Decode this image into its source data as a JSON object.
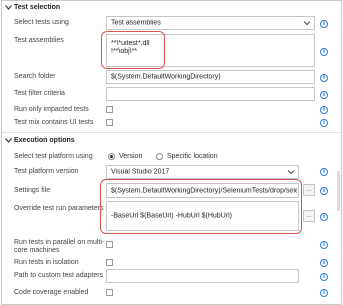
{
  "test_selection": {
    "title": "Test selection",
    "select_tests_using": {
      "label": "Select tests using",
      "value": "Test assemblies"
    },
    "test_assemblies": {
      "label": "Test assemblies",
      "value": "**\\*uitest*.dll\n!**\\obj\\**"
    },
    "search_folder": {
      "label": "Search folder",
      "value": "$(System.DefaultWorkingDirectory)"
    },
    "test_filter_criteria": {
      "label": "Test filter criteria",
      "value": ""
    },
    "run_only_impacted": {
      "label": "Run only impacted tests"
    },
    "test_mix_ui": {
      "label": "Test mix contains UI tests"
    }
  },
  "execution_options": {
    "title": "Execution options",
    "select_platform": {
      "label": "Select test platform using",
      "option_version": "Version",
      "option_location": "Specific location"
    },
    "platform_version": {
      "label": "Test platform version",
      "value": "Visual Studio 2017"
    },
    "settings_file": {
      "label": "Settings file",
      "value": "$(System.DefaultWorkingDirectory)/SeleniumTests/drop/sele",
      "browse": "..."
    },
    "override_params": {
      "label": "Override test run parameters",
      "value": "-BaseUrl $(BaseUrl) -HubUrl $(HubUrl)",
      "browse": "..."
    },
    "run_parallel": {
      "label_line1": "Run tests in parallel on multi-",
      "label_line2": "core machines"
    },
    "run_isolation": {
      "label": "Run tests in isolation"
    },
    "custom_adapters": {
      "label": "Path to custom test adapters",
      "value": ""
    },
    "code_coverage": {
      "label": "Code coverage enabled"
    }
  },
  "icons": {
    "info": "info-icon",
    "info_glyph": "i",
    "section_toggle": "chevron-down-icon",
    "dropdown": "chevron-down-icon"
  },
  "colors": {
    "highlight": "#d9534f",
    "info": "#2b79d8"
  }
}
